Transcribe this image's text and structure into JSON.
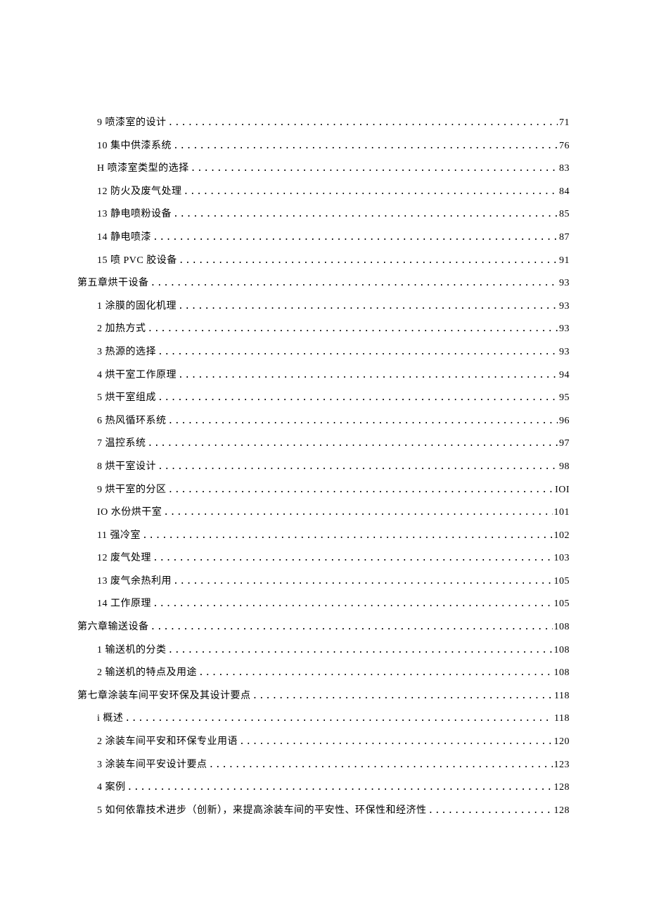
{
  "dots": ".........................................................................................................................................................",
  "entries": [
    {
      "indent": 1,
      "label": "9 喷漆室的设计",
      "page": "71"
    },
    {
      "indent": 1,
      "label": "10 集中供漆系统",
      "page": "76"
    },
    {
      "indent": 1,
      "label": "H 喷漆室类型的选择",
      "page": "83"
    },
    {
      "indent": 1,
      "label": "12 防火及废气处理",
      "page": "84"
    },
    {
      "indent": 1,
      "label": "13 静电喷粉设备",
      "page": "85"
    },
    {
      "indent": 1,
      "label": "14 静电喷漆",
      "page": "87"
    },
    {
      "indent": 1,
      "label": "15 喷 PVC 胶设备 ",
      "page": "91"
    },
    {
      "indent": 0,
      "label": "第五章烘干设备 ",
      "page": "93"
    },
    {
      "indent": 1,
      "label": "1 涂膜的固化机理",
      "page": "93"
    },
    {
      "indent": 1,
      "label": "2 加热方式",
      "page": "93"
    },
    {
      "indent": 1,
      "label": "3 热源的选择",
      "page": "93"
    },
    {
      "indent": 1,
      "label": "4 烘干室工作原理",
      "page": "94"
    },
    {
      "indent": 1,
      "label": "5 烘干室组成",
      "page": "95"
    },
    {
      "indent": 1,
      "label": "6 热风循环系统",
      "page": "96"
    },
    {
      "indent": 1,
      "label": "7 温控系统",
      "page": "97"
    },
    {
      "indent": 1,
      "label": "8 烘干室设计",
      "page": "98"
    },
    {
      "indent": 1,
      "label": "9 烘干室的分区 ",
      "page": "IOI"
    },
    {
      "indent": 1,
      "label": "IO 水份烘干室",
      "page": "101"
    },
    {
      "indent": 1,
      "label": "11 强冷室",
      "page": "102"
    },
    {
      "indent": 1,
      "label": "12 废气处理",
      "page": "103"
    },
    {
      "indent": 1,
      "label": "13    废气余热利用 ",
      "page": "105"
    },
    {
      "indent": 1,
      "label": "14    工作原理 ",
      "page": "105"
    },
    {
      "indent": 0,
      "label": "第六章输送设备 ",
      "page": "108"
    },
    {
      "indent": 1,
      "label": "1 输送机的分类",
      "page": "108"
    },
    {
      "indent": 1,
      "label": "2 输送机的特点及用途 ",
      "page": "108"
    },
    {
      "indent": 0,
      "label": "第七章涂装车间平安环保及其设计要点 ",
      "page": "118"
    },
    {
      "indent": 1,
      "label": "i 概述",
      "page": "118"
    },
    {
      "indent": 1,
      "label": "2 涂装车间平安和环保专业用语 ",
      "page": "120"
    },
    {
      "indent": 1,
      "label": "3 涂装车间平安设计要点 ",
      "page": "123"
    },
    {
      "indent": 1,
      "label": "4 案例",
      "page": "128"
    },
    {
      "indent": 1,
      "label": "5 如何依靠技术进步（创新），来提高涂装车间的平安性、环保性和经济性",
      "page": "128"
    }
  ]
}
